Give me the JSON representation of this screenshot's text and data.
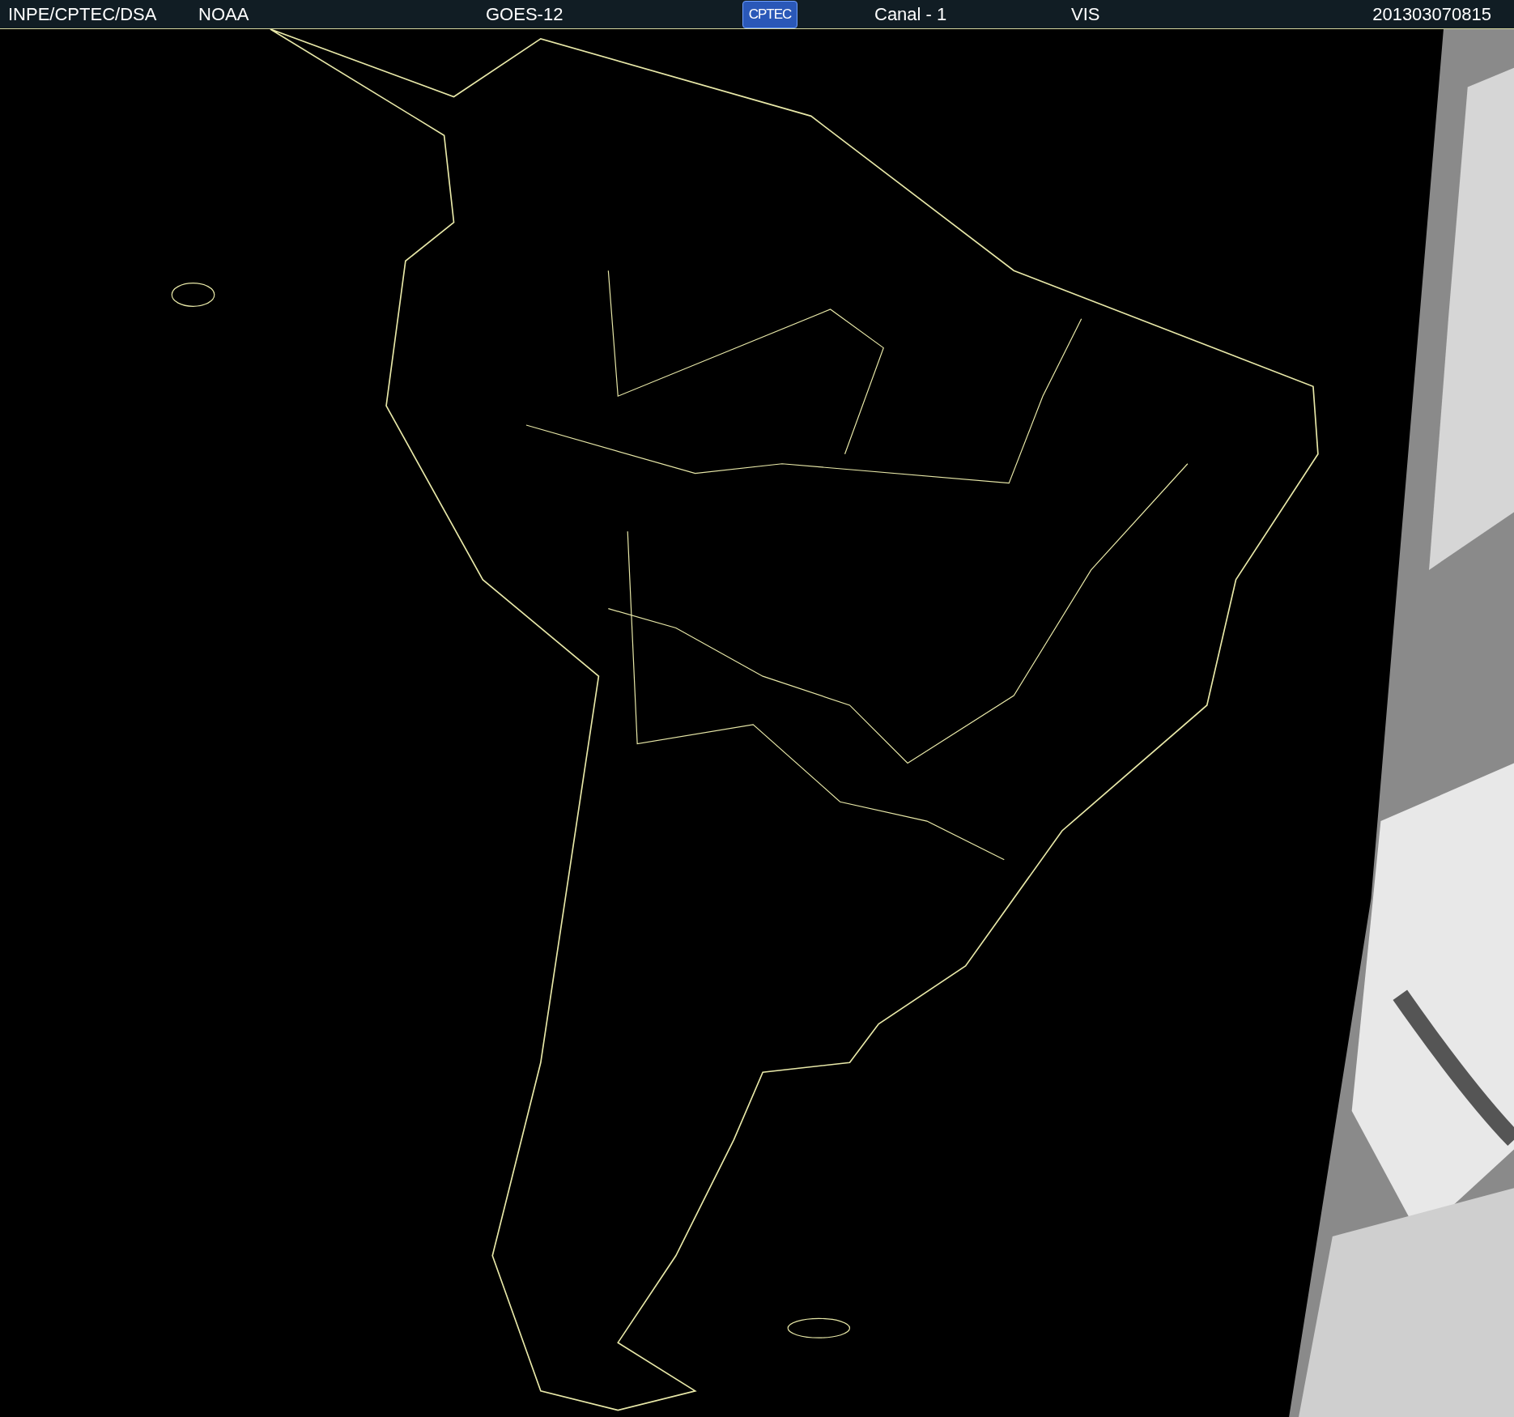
{
  "header": {
    "items": [
      {
        "kind": "text",
        "text": "INPE/CPTEC/DSA"
      },
      {
        "kind": "text",
        "text": "NOAA"
      },
      {
        "kind": "text",
        "text": "GOES-12"
      },
      {
        "kind": "logo",
        "text": "CPTEC"
      },
      {
        "kind": "text",
        "text": "Canal - 1"
      },
      {
        "kind": "text",
        "text": "VIS"
      },
      {
        "kind": "text",
        "text": "201303070815"
      }
    ]
  }
}
